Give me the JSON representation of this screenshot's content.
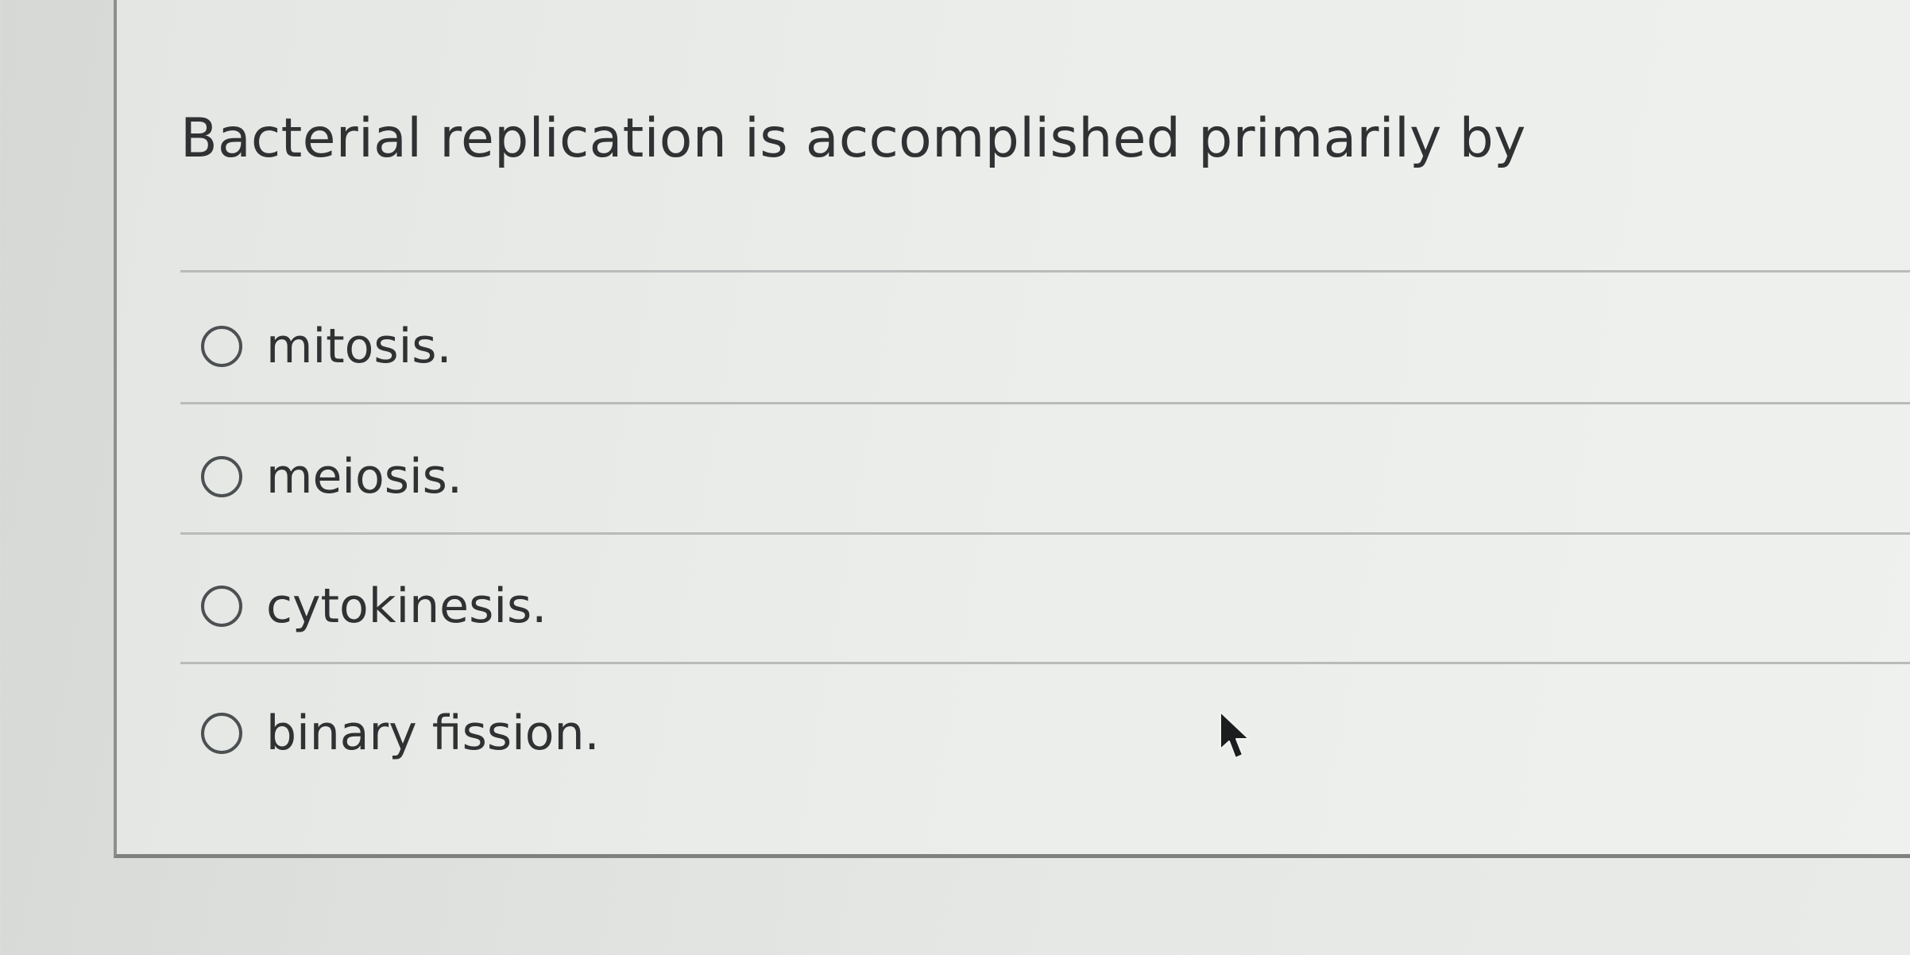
{
  "question": {
    "text": "Bacterial replication is accomplished primarily by"
  },
  "options": [
    {
      "label": "mitosis.",
      "selected": false
    },
    {
      "label": "meiosis.",
      "selected": false
    },
    {
      "label": "cytokinesis.",
      "selected": false
    },
    {
      "label": "binary fission.",
      "selected": false
    }
  ],
  "icons": {
    "radio": "radio-unselected-icon",
    "cursor": "mouse-pointer-icon"
  },
  "colors": {
    "text": "#2f3132",
    "radio_border": "#4d5052",
    "divider": "#b9bbbb",
    "card_border": "#8d8f8f"
  }
}
